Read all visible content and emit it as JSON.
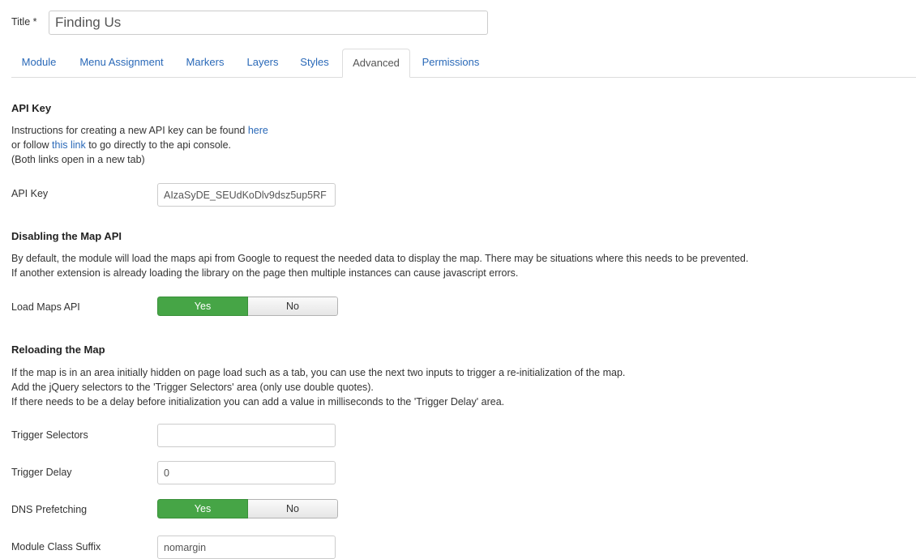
{
  "title": {
    "label": "Title *",
    "value": "Finding Us"
  },
  "tabs": [
    {
      "label": "Module"
    },
    {
      "label": "Menu Assignment"
    },
    {
      "label": "Markers"
    },
    {
      "label": "Layers"
    },
    {
      "label": "Styles"
    },
    {
      "label": "Advanced",
      "active": true
    },
    {
      "label": "Permissions"
    }
  ],
  "api_key_section": {
    "heading": "API Key",
    "line1_pre": "Instructions for creating a new API key can be found ",
    "line1_link": "here",
    "line2_pre": "or follow ",
    "line2_link": "this link",
    "line2_post": " to go directly to the api console.",
    "line3": "(Both links open in a new tab)",
    "field_label": "API Key",
    "field_value": "AIzaSyDE_SEUdKoDlv9dsz5up5RF"
  },
  "disable_section": {
    "heading": "Disabling the Map API",
    "line1": "By default, the module will load the maps api from Google to request the needed data to display the map. There may be situations where this needs to be prevented.",
    "line2": "If another extension is already loading the library on the page then multiple instances can cause javascript errors.",
    "field_label": "Load Maps API",
    "yes": "Yes",
    "no": "No"
  },
  "reload_section": {
    "heading": "Reloading the Map",
    "line1": "If the map is in an area initially hidden on page load such as a tab, you can use the next two inputs to trigger a re-initialization of the map.",
    "line2": "Add the jQuery selectors to the 'Trigger Selectors' area (only use double quotes).",
    "line3": "If there needs to be a delay before initialization you can add a value in milliseconds to the 'Trigger Delay' area.",
    "trigger_selectors_label": "Trigger Selectors",
    "trigger_selectors_value": "",
    "trigger_delay_label": "Trigger Delay",
    "trigger_delay_value": "0",
    "dns_label": "DNS Prefetching",
    "dns_yes": "Yes",
    "dns_no": "No",
    "suffix_label": "Module Class Suffix",
    "suffix_value": "nomargin"
  },
  "colors": {
    "link": "#2a69b8",
    "toggle_on": "#46a546"
  }
}
